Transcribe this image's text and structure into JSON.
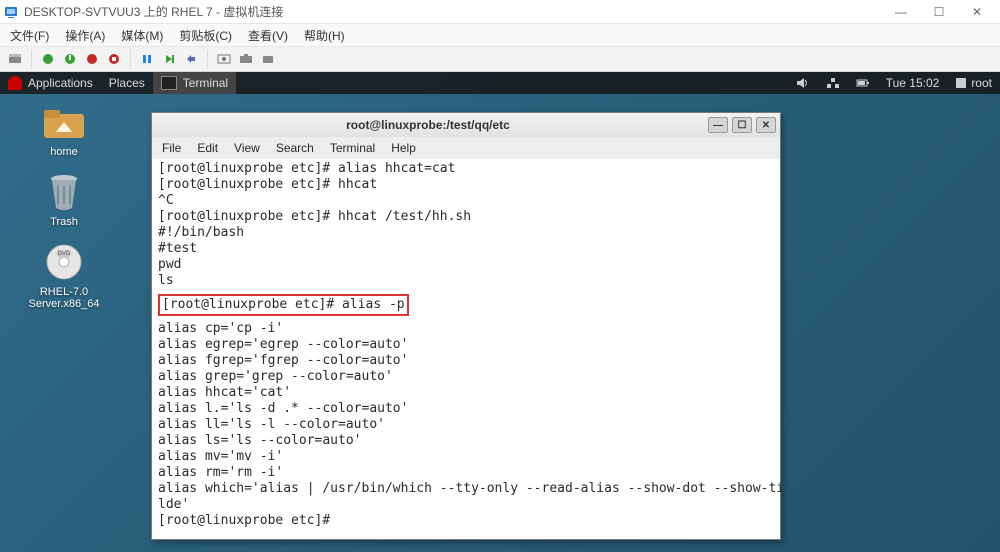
{
  "window": {
    "title": "DESKTOP-SVTVUU3 上的 RHEL 7 - 虚拟机连接",
    "min": "—",
    "max": "☐",
    "close": "✕"
  },
  "menubar": {
    "file": "文件(F)",
    "action": "操作(A)",
    "media": "媒体(M)",
    "clipboard": "剪贴板(C)",
    "view": "查看(V)",
    "help": "帮助(H)"
  },
  "gnome_panel": {
    "applications": "Applications",
    "places": "Places",
    "terminal": "Terminal",
    "time": "Tue 15:02",
    "user": "root"
  },
  "desktop": {
    "home": "home",
    "trash": "Trash",
    "rhel": "RHEL-7.0 Server.x86_64"
  },
  "terminal": {
    "title": "root@linuxprobe:/test/qq/etc",
    "menu": {
      "file": "File",
      "edit": "Edit",
      "view": "View",
      "search": "Search",
      "terminal": "Terminal",
      "help": "Help"
    },
    "lines": {
      "l1": "[root@linuxprobe etc]# alias hhcat=cat",
      "l2": "[root@linuxprobe etc]# hhcat",
      "l3": "^C",
      "l4": "[root@linuxprobe etc]# hhcat /test/hh.sh",
      "l5": "#!/bin/bash",
      "l6": "#test",
      "l7": "pwd",
      "l8": "ls",
      "hl": "[root@linuxprobe etc]# alias -p",
      "a1": "alias cp='cp -i'",
      "a2": "alias egrep='egrep --color=auto'",
      "a3": "alias fgrep='fgrep --color=auto'",
      "a4": "alias grep='grep --color=auto'",
      "a5": "alias hhcat='cat'",
      "a6": "alias l.='ls -d .* --color=auto'",
      "a7": "alias ll='ls -l --color=auto'",
      "a8": "alias ls='ls --color=auto'",
      "a9": "alias mv='mv -i'",
      "a10": "alias rm='rm -i'",
      "a11": "alias which='alias | /usr/bin/which --tty-only --read-alias --show-dot --show-ti",
      "a12": "lde'",
      "prompt": "[root@linuxprobe etc]# "
    }
  }
}
